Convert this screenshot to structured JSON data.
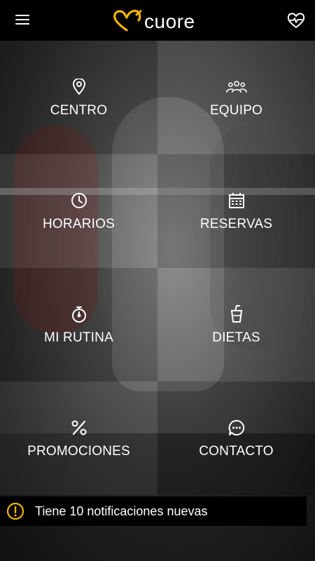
{
  "header": {
    "logo_text": "cuore",
    "menu_icon": "hamburger-menu-icon",
    "heart_icon": "heart-pulse-icon"
  },
  "menu": {
    "items": [
      {
        "label": "CENTRO",
        "icon": "location-pin-icon"
      },
      {
        "label": "EQUIPO",
        "icon": "group-people-icon"
      },
      {
        "label": "HORARIOS",
        "icon": "clock-icon"
      },
      {
        "label": "RESERVAS",
        "icon": "calendar-icon"
      },
      {
        "label": "MI RUTINA",
        "icon": "stopwatch-icon"
      },
      {
        "label": "DIETAS",
        "icon": "cup-icon"
      },
      {
        "label": "PROMOCIONES",
        "icon": "percent-icon"
      },
      {
        "label": "CONTACTO",
        "icon": "chat-bubble-icon"
      }
    ]
  },
  "notification": {
    "text": "Tiene 10 notificaciones nuevas",
    "icon": "warning-circle-icon"
  },
  "colors": {
    "accent": "#f4b400",
    "topbar": "#000000",
    "text": "#ffffff"
  }
}
